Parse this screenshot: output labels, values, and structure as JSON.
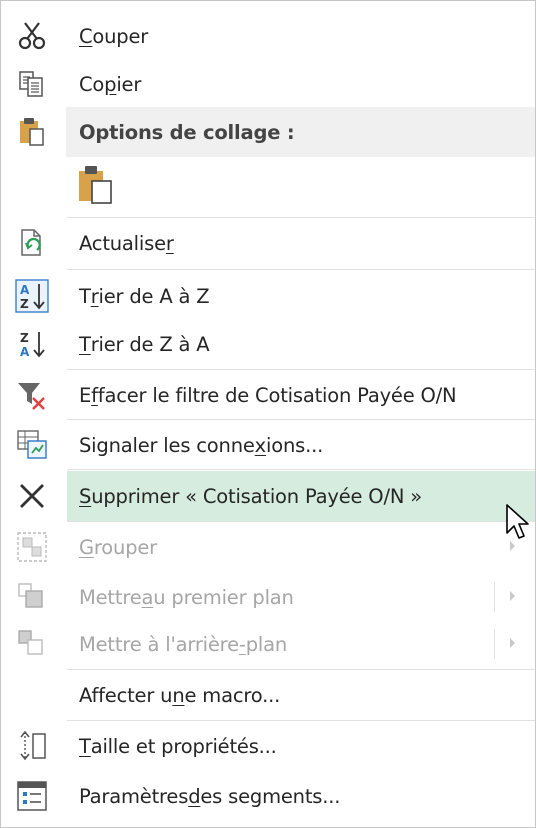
{
  "menu": {
    "cut": {
      "pre": "",
      "u": "C",
      "post": "ouper",
      "icon": "scissors-icon"
    },
    "copy": {
      "pre": "Co",
      "u": "p",
      "post": "ier",
      "icon": "copy-icon"
    },
    "paste_options": {
      "label": "Options de collage :",
      "icon": "clipboard-icon"
    },
    "paste_button": {
      "icon": "paste-icon"
    },
    "refresh": {
      "pre": "Actualise",
      "u": "r",
      "post": "",
      "icon": "refresh-icon"
    },
    "sort_az": {
      "pre": "T",
      "u": "r",
      "post": "ier de A à Z",
      "icon": "sort-ascending-icon"
    },
    "sort_za": {
      "pre": "",
      "u": "T",
      "post": "rier de Z à A",
      "icon": "sort-descending-icon"
    },
    "clear_filter": {
      "pre": "E",
      "u": "f",
      "post": "facer le filtre de Cotisation Payée O/N",
      "icon": "clear-filter-icon"
    },
    "connections": {
      "pre": "Signaler les conne",
      "u": "x",
      "post": "ions...",
      "icon": "connections-icon"
    },
    "delete": {
      "pre": "",
      "u": "S",
      "post": "upprimer « Cotisation Payée O/N »",
      "icon": "delete-x-icon"
    },
    "group": {
      "pre": "",
      "u": "G",
      "post": "rouper",
      "icon": "group-icon"
    },
    "bring_front": {
      "pre": "Mettre ",
      "u": "a",
      "post": "u premier plan",
      "icon": "bring-to-front-icon"
    },
    "send_back": {
      "pre": "Mettre à l'arrière",
      "u": "-",
      "post": "plan",
      "icon": "send-to-back-icon"
    },
    "macro": {
      "pre": "Affecter u",
      "u": "n",
      "post": "e macro..."
    },
    "size": {
      "pre": "",
      "u": "T",
      "post": "aille et propriétés...",
      "icon": "size-properties-icon"
    },
    "slicer_settings": {
      "pre": "Paramètres ",
      "u": "d",
      "post": "es segments...",
      "icon": "slicer-settings-icon"
    }
  },
  "colors": {
    "hover_bg": "#d6ecdf",
    "header_bg": "#f0f0f0",
    "disabled_text": "#a6a6a6",
    "text": "#262626",
    "accent_blue": "#2b78c5",
    "accent_green": "#2e9e57",
    "accent_red": "#e04040"
  }
}
